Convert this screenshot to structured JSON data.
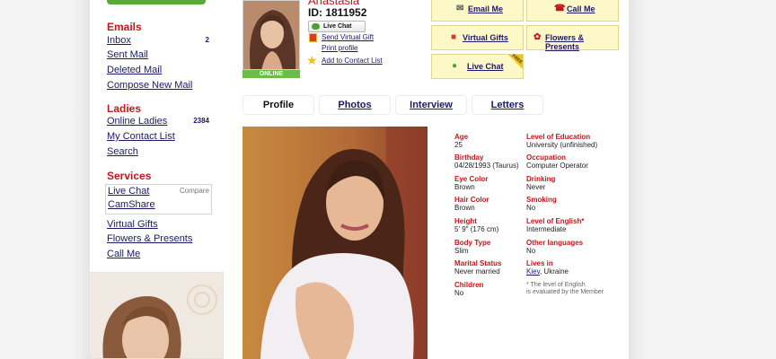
{
  "sidebar": {
    "emails": {
      "title": "Emails",
      "items": [
        {
          "label": "Inbox",
          "count": "2"
        },
        {
          "label": "Sent Mail"
        },
        {
          "label": "Deleted Mail"
        },
        {
          "label": "Compose New Mail"
        }
      ]
    },
    "ladies": {
      "title": "Ladies",
      "items": [
        {
          "label": "Online Ladies",
          "count": "2384"
        },
        {
          "label": "My Contact List"
        },
        {
          "label": "Search"
        }
      ]
    },
    "services": {
      "title": "Services",
      "compare": "Compare",
      "items": [
        {
          "label": "Live Chat"
        },
        {
          "label": "CamShare"
        },
        {
          "label": "Virtual Gifts"
        },
        {
          "label": "Flowers & Presents"
        },
        {
          "label": "Call Me"
        }
      ]
    }
  },
  "profile": {
    "name": "Anastasia",
    "id": "ID: 1811952",
    "online_badge": "ONLINE",
    "live_chat_button": "Live Chat",
    "send_gift": "Send Virtual Gift",
    "print_profile": "Print profile",
    "add_contact": "Add to Contact List"
  },
  "actions": {
    "email_me": "Email Me",
    "call_me": "Call Me",
    "virtual_gifts": "Virtual Gifts",
    "flowers": "Flowers & Presents",
    "live_chat": "Live Chat",
    "free_tag": "FREE"
  },
  "tabs": [
    {
      "label": "Profile",
      "active": true
    },
    {
      "label": "Photos"
    },
    {
      "label": "Interview"
    },
    {
      "label": "Letters"
    }
  ],
  "info": {
    "left": [
      {
        "label": "Age",
        "value": "25"
      },
      {
        "label": "Birthday",
        "value": "04/28/1993 (Taurus)"
      },
      {
        "label": "Eye Color",
        "value": "Brown"
      },
      {
        "label": "Hair Color",
        "value": "Brown"
      },
      {
        "label": "Height",
        "value": "5' 9\" (176 cm)"
      },
      {
        "label": "Body Type",
        "value": "Slim"
      },
      {
        "label": "Marital Status",
        "value": "Never married"
      },
      {
        "label": "Children",
        "value": "No"
      }
    ],
    "right": [
      {
        "label": "Level of Education",
        "value": "University (unfinished)"
      },
      {
        "label": "Occupation",
        "value": "Computer Operator"
      },
      {
        "label": "Drinking",
        "value": "Never"
      },
      {
        "label": "Smoking",
        "value": "No"
      },
      {
        "label": "Level of English*",
        "value": "Intermediate"
      },
      {
        "label": "Other languages",
        "value": "No"
      },
      {
        "label": "Lives in",
        "city": "Kiev",
        "country": ", Ukraine"
      }
    ],
    "note_line1": "* The level of English",
    "note_line2": "is evaluated by the Member"
  },
  "colors": {
    "accent_red": "#c4161c",
    "link_blue": "#1a1a66",
    "online_green": "#6cbd45",
    "action_yellow": "#fdf8c8"
  }
}
